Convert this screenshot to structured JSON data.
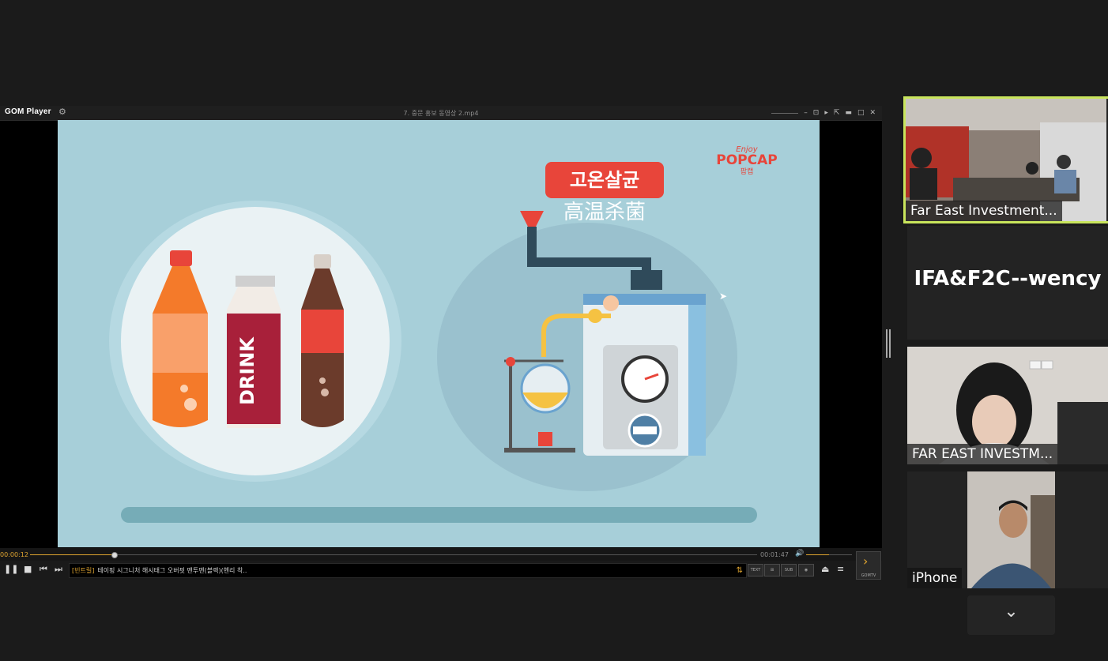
{
  "player": {
    "app_name": "GOM Player",
    "file_title": "7. 중문 홍보 동영상 2.mp4",
    "time_current": "00:00:12",
    "time_total": "00:01:47",
    "progress_fraction": 0.115,
    "volume_fraction": 0.5,
    "ticker_tag": "[빈트릴]",
    "ticker_text": "테이핑 시그니처 해시태그 오버핏 맨투맨(블랙)(헨리 착..",
    "ticker_arrows": "⇅",
    "buttons": {
      "play_pause": "❚❚",
      "stop": "■",
      "prev": "⏮",
      "next": "⏭",
      "eject": "⏏",
      "menu": "≡",
      "sub": "SUB",
      "text": "TEXT",
      "gomtv_arrow": "›",
      "gomtv_label": "GOMTV"
    }
  },
  "video": {
    "badge_korean": "고온살균",
    "caption_chinese": "高温杀菌",
    "bottle_label": "DRINK",
    "logo_top": "Enjoy",
    "logo_main": "POPCAP",
    "logo_sub": "팝캡"
  },
  "participants": [
    {
      "name": "Far East Investment..."
    },
    {
      "name": "IFA&F2C--wency"
    },
    {
      "name": "FAR EAST INVESTM..."
    },
    {
      "name": "iPhone"
    }
  ],
  "more_button": "⌄",
  "colors": {
    "active_speaker_border": "#c9e55c",
    "accent": "#e0a530",
    "video_bg": "#a7cfd9"
  }
}
